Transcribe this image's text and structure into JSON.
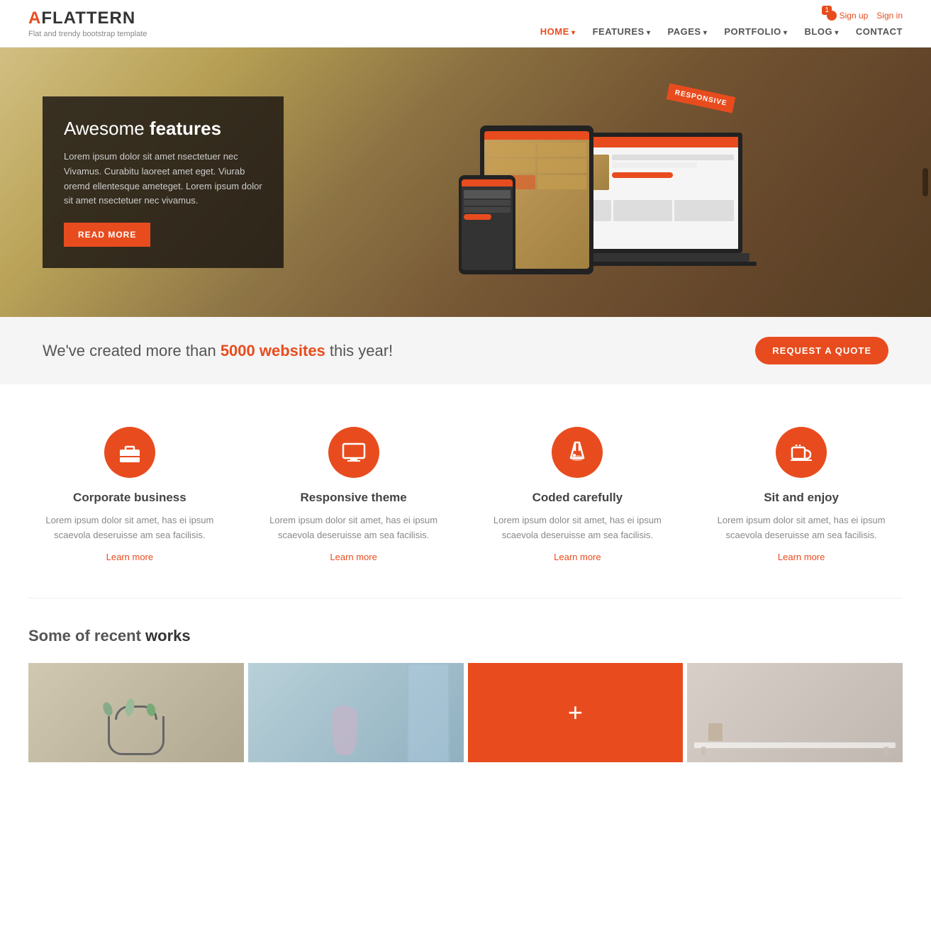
{
  "brand": {
    "name_prefix": "A",
    "name_suffix": "FLATTERN",
    "tagline": "Flat and trendy bootstrap template"
  },
  "header": {
    "auth": {
      "signup": "Sign up",
      "signin": "Sign in",
      "notification_count": "1"
    },
    "nav": [
      {
        "label": "HOME",
        "active": true,
        "has_arrow": true
      },
      {
        "label": "FEATURES",
        "active": false,
        "has_arrow": true
      },
      {
        "label": "PAGES",
        "active": false,
        "has_arrow": true
      },
      {
        "label": "PORTFOLIO",
        "active": false,
        "has_arrow": true
      },
      {
        "label": "BLOG",
        "active": false,
        "has_arrow": true
      },
      {
        "label": "CONTACT",
        "active": false,
        "has_arrow": false
      }
    ]
  },
  "hero": {
    "title_plain": "Awesome ",
    "title_bold": "features",
    "description": "Lorem ipsum dolor sit amet nsectetuer nec Vivamus. Curabitu laoreet amet eget. Viurab oremd ellentesque ameteget. Lorem ipsum dolor sit amet nsectetuer nec vivamus.",
    "button_label": "READ MORE",
    "badge": "Responsive"
  },
  "quote_bar": {
    "text_start": "We've created more than ",
    "highlight": "5000 websites",
    "text_end": " this year!",
    "button_label": "REQUEST A QUOTE"
  },
  "features": [
    {
      "icon": "briefcase",
      "title": "Corporate business",
      "description": "Lorem ipsum dolor sit amet, has ei ipsum scaevola deseruisse am sea facilisis.",
      "link": "Learn more"
    },
    {
      "icon": "monitor",
      "title": "Responsive theme",
      "description": "Lorem ipsum dolor sit amet, has ei ipsum scaevola deseruisse am sea facilisis.",
      "link": "Learn more"
    },
    {
      "icon": "flask",
      "title": "Coded carefully",
      "description": "Lorem ipsum dolor sit amet, has ei ipsum scaevola deseruisse am sea facilisis.",
      "link": "Learn more"
    },
    {
      "icon": "coffee",
      "title": "Sit and enjoy",
      "description": "Lorem ipsum dolor sit amet, has ei ipsum scaevola deseruisse am sea facilisis.",
      "link": "Learn more"
    }
  ],
  "recent_works": {
    "title_plain": "Some of recent ",
    "title_bold": "works"
  },
  "colors": {
    "accent": "#e84c1e",
    "text_dark": "#333",
    "text_mid": "#555",
    "text_light": "#888"
  }
}
